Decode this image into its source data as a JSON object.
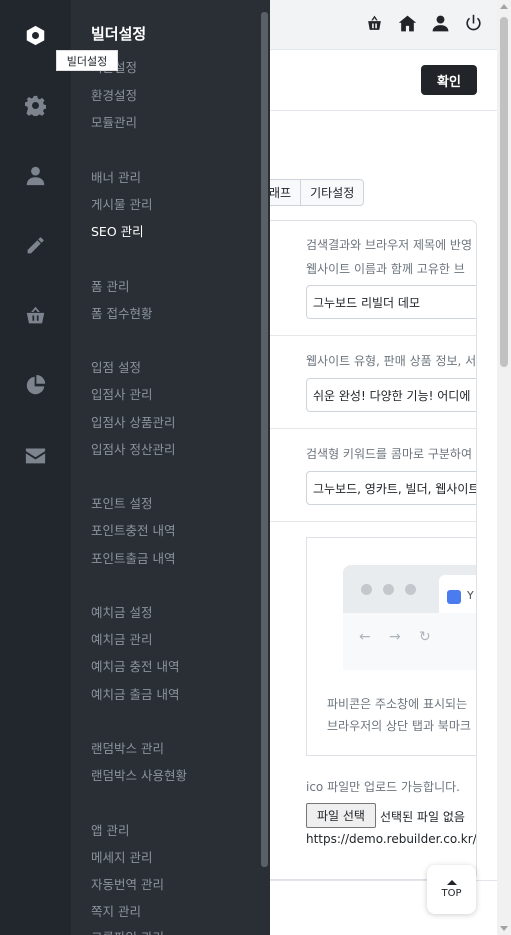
{
  "header": {
    "icons": [
      "basket-icon",
      "home-icon",
      "user-icon",
      "power-icon"
    ]
  },
  "toolbar": {
    "confirm_label": "확인"
  },
  "tabs": [
    "래프",
    "기타설정"
  ],
  "form": {
    "title_help_1": "검색결과와 브라우저 제목에 반영",
    "title_help_2": "웹사이트 이름과 함께 고유한 브",
    "title_value": "그누보드 리빌더 데모",
    "desc_help": "웹사이트 유형, 판매 상품 정보, 서",
    "desc_value": "쉬운 완성! 다양한 기능! 어디에",
    "keyword_help": "검색형 키워드를 콤마로 구분하여",
    "keyword_value": "그누보드, 영카트, 빌더, 웹사이트",
    "favicon_tab_letter": "Y",
    "favicon_text_1": "파비콘은 주소창에 표시되는",
    "favicon_text_2": "브라우저의 상단 탭과 북마크",
    "upload_note": "ico 파일만 업로드 가능합니다.",
    "file_button": "파일 선택",
    "file_status": "선택된 파일 없음",
    "url": "https://demo.rebuilder.co.kr/"
  },
  "top_button": "TOP",
  "sidebar": {
    "tooltip": "빌더설정",
    "title": "빌더설정",
    "rail_icons": [
      "hexagon-icon",
      "gear-icon",
      "user-icon",
      "pencil-icon",
      "basket-icon",
      "pie-chart-icon",
      "mail-icon"
    ],
    "groups": [
      [
        "기본설정",
        "환경설정",
        "모듈관리"
      ],
      [
        "배너 관리",
        "게시물 관리",
        "SEO 관리"
      ],
      [
        "폼 관리",
        "폼 접수현황"
      ],
      [
        "입점 설정",
        "입점사 관리",
        "입점사 상품관리",
        "입점사 정산관리"
      ],
      [
        "포인트 설정",
        "포인트충전 내역",
        "포인트출금 내역"
      ],
      [
        "예치금 설정",
        "예치금 관리",
        "예치금 충전 내역",
        "예치금 출금 내역"
      ],
      [
        "랜덤박스 관리",
        "랜덤박스 사용현황"
      ],
      [
        "앱 관리",
        "메세지 관리",
        "자동번역 관리",
        "쪽지 관리",
        "크롬파일 관리"
      ]
    ],
    "active_item": "SEO 관리"
  }
}
